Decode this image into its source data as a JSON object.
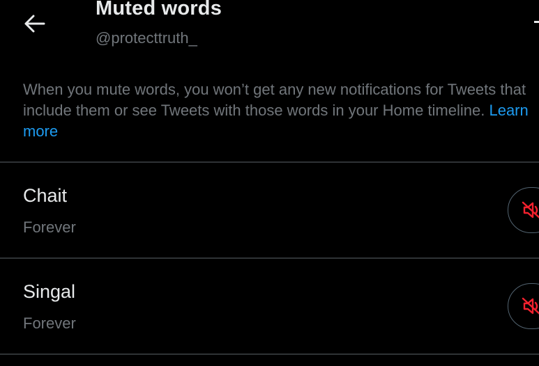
{
  "header": {
    "back_icon": "arrow-left-icon",
    "title": "Muted words",
    "handle": "@protecttruth_",
    "add_icon": "plus-icon"
  },
  "description": {
    "text": "When you mute words, you won’t get any new notifications for Tweets that include them or see Tweets with those words in your Home timeline. ",
    "link_text": "Learn more"
  },
  "muted_words": [
    {
      "word": "Chait",
      "duration": "Forever",
      "action_icon": "unmute-speaker-icon"
    },
    {
      "word": "Singal",
      "duration": "Forever",
      "action_icon": "unmute-speaker-icon"
    }
  ],
  "colors": {
    "background": "#000000",
    "primary_text": "#e7e9ea",
    "secondary_text": "#71767b",
    "link": "#1d9bf0",
    "divider": "#2f3336",
    "mute_icon": "#f4212e"
  }
}
